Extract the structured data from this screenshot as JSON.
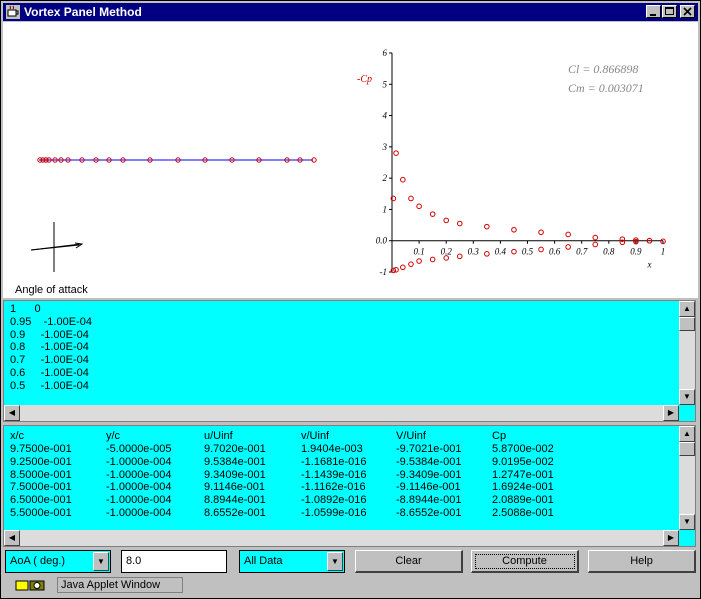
{
  "window": {
    "title": "Vortex Panel Method"
  },
  "plot": {
    "cl_text": "Cl = 0.866898",
    "cm_text": "Cm = 0.003071",
    "cp_label": "-Cp",
    "x_label": "x",
    "angle_label": "Angle of attack",
    "y_ticks": [
      "6",
      "5",
      "4",
      "3",
      "2",
      "1",
      "0.0",
      "-1"
    ],
    "x_ticks": [
      "0.1",
      "0.2",
      "0.3",
      "0.4",
      "0.5",
      "0.6",
      "0.7",
      "0.8",
      "0.9",
      "1"
    ]
  },
  "chart_data": {
    "type": "scatter",
    "xlabel": "x",
    "ylabel": "-Cp",
    "xlim": [
      0,
      1
    ],
    "ylim": [
      -1,
      6
    ],
    "series": [
      {
        "x": [
          0.005,
          0.015,
          0.04,
          0.07,
          0.1,
          0.15,
          0.2,
          0.25,
          0.35,
          0.45,
          0.55,
          0.65,
          0.75,
          0.85,
          0.9,
          0.95,
          1.0
        ],
        "y": [
          1.35,
          2.8,
          1.95,
          1.35,
          1.1,
          0.85,
          0.65,
          0.55,
          0.45,
          0.35,
          0.27,
          0.2,
          0.1,
          0.05,
          0.02,
          0.0,
          -0.02
        ]
      },
      {
        "x": [
          0.005,
          0.015,
          0.04,
          0.07,
          0.1,
          0.15,
          0.2,
          0.25,
          0.35,
          0.45,
          0.55,
          0.65,
          0.75,
          0.85,
          0.9,
          0.95
        ],
        "y": [
          -0.95,
          -0.93,
          -0.85,
          -0.75,
          -0.65,
          -0.6,
          -0.55,
          -0.5,
          -0.42,
          -0.35,
          -0.28,
          -0.2,
          -0.12,
          -0.05,
          -0.03,
          0.0
        ]
      }
    ]
  },
  "panel1": {
    "rows": [
      "1      0",
      "0.95    -1.00E-04",
      "0.9     -1.00E-04",
      "0.8     -1.00E-04",
      "0.7     -1.00E-04",
      "0.6     -1.00E-04",
      "0.5     -1.00E-04"
    ]
  },
  "table": {
    "headers": [
      "x/c",
      "y/c",
      "u/Uinf",
      "v/Uinf",
      "V/Uinf",
      "Cp"
    ],
    "rows": [
      [
        "9.7500e-001",
        "-5.0000e-005",
        "9.7020e-001",
        "1.9404e-003",
        "-9.7021e-001",
        "5.8700e-002"
      ],
      [
        "9.2500e-001",
        "-1.0000e-004",
        "9.5384e-001",
        "-1.1681e-016",
        "-9.5384e-001",
        "9.0195e-002"
      ],
      [
        "8.5000e-001",
        "-1.0000e-004",
        "9.3409e-001",
        "-1.1439e-016",
        "-9.3409e-001",
        "1.2747e-001"
      ],
      [
        "7.5000e-001",
        "-1.0000e-004",
        "9.1146e-001",
        "-1.1162e-016",
        "-9.1146e-001",
        "1.6924e-001"
      ],
      [
        "6.5000e-001",
        "-1.0000e-004",
        "8.8944e-001",
        "-1.0892e-016",
        "-8.8944e-001",
        "2.0889e-001"
      ],
      [
        "5.5000e-001",
        "-1.0000e-004",
        "8.6552e-001",
        "-1.0599e-016",
        "-8.6552e-001",
        "2.5088e-001"
      ]
    ]
  },
  "controls": {
    "param_select": "AoA ( deg.)",
    "param_value": "8.0",
    "data_select": "All Data",
    "clear_label": "Clear",
    "compute_label": "Compute",
    "help_label": "Help"
  },
  "status": {
    "text": "Java Applet Window"
  }
}
